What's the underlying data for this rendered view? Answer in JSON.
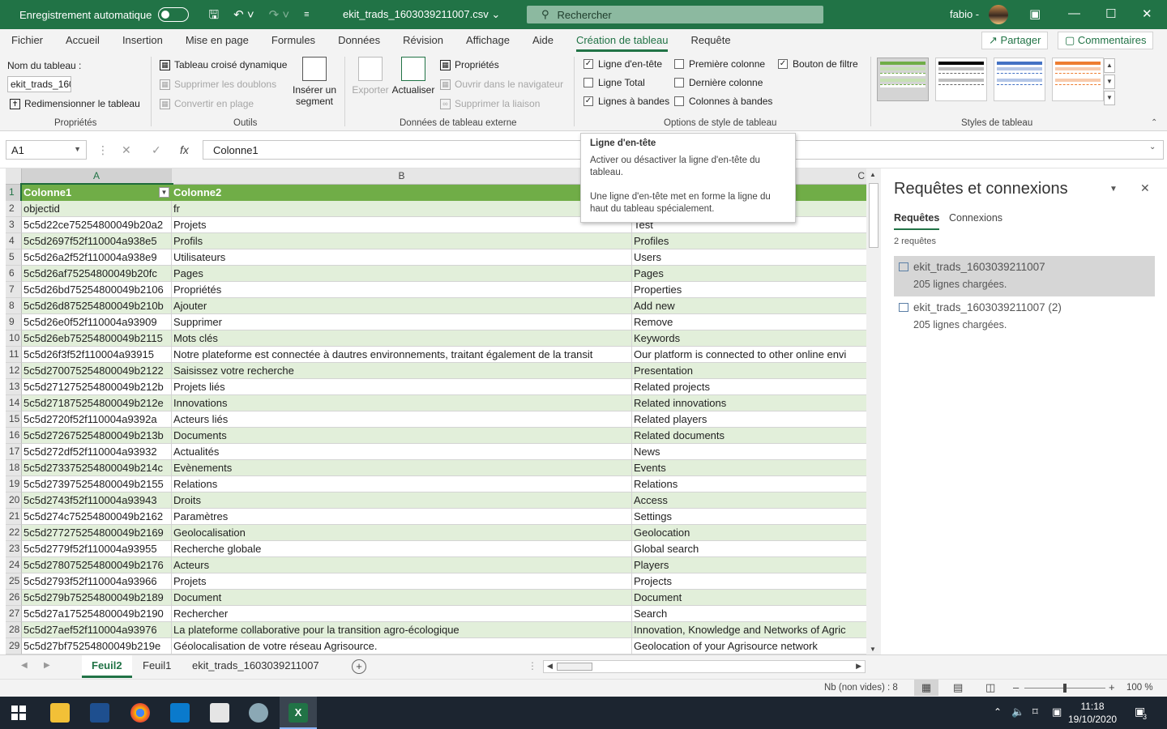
{
  "titlebar": {
    "autosave_label": "Enregistrement automatique",
    "doc_title": "ekit_trads_1603039211007.csv  ⌄",
    "search_placeholder": "Rechercher",
    "user_name": "fabio -"
  },
  "menu": {
    "tabs": [
      "Fichier",
      "Accueil",
      "Insertion",
      "Mise en page",
      "Formules",
      "Données",
      "Révision",
      "Affichage",
      "Aide",
      "Création de tableau",
      "Requête"
    ],
    "share_label": "Partager",
    "comments_label": "Commentaires"
  },
  "ribbon": {
    "props": {
      "name_label": "Nom du tableau :",
      "name_value": "ekit_trads_160",
      "resize_label": "Redimensionner le tableau",
      "group": "Propriétés"
    },
    "tools": {
      "pivot": "Tableau croisé dynamique",
      "remove_dup": "Supprimer les doublons",
      "convert": "Convertir en plage",
      "slicer": "Insérer un segment",
      "group": "Outils"
    },
    "external": {
      "export": "Exporter",
      "refresh": "Actualiser",
      "properties": "Propriétés",
      "open_browser": "Ouvrir dans le navigateur",
      "unlink": "Supprimer la liaison",
      "group": "Données de tableau externe"
    },
    "style_opts": {
      "header_row": "Ligne d'en-tête",
      "total_row": "Ligne Total",
      "banded_rows": "Lignes à bandes",
      "first_col": "Première colonne",
      "last_col": "Dernière colonne",
      "banded_cols": "Colonnes à bandes",
      "filter_btn": "Bouton de filtre",
      "group": "Options de style de tableau"
    },
    "styles_group": "Styles de tableau"
  },
  "formula": {
    "cell_ref": "A1",
    "content": "Colonne1"
  },
  "grid": {
    "col_headers": [
      "A",
      "B",
      "C"
    ],
    "header_row": [
      "Colonne1",
      "Colonne2"
    ],
    "rows": [
      [
        "objectid",
        "fr",
        ""
      ],
      [
        "5c5d22ce75254800049b20a2",
        "Projets",
        "Test"
      ],
      [
        "5c5d2697f52f110004a938e5",
        "Profils",
        "Profiles"
      ],
      [
        "5c5d26a2f52f110004a938e9",
        "Utilisateurs",
        "Users"
      ],
      [
        "5c5d26af75254800049b20fc",
        "Pages",
        "Pages"
      ],
      [
        "5c5d26bd75254800049b2106",
        "Propriétés",
        "Properties"
      ],
      [
        "5c5d26d875254800049b210b",
        "Ajouter",
        "Add new"
      ],
      [
        "5c5d26e0f52f110004a93909",
        "Supprimer",
        "Remove"
      ],
      [
        "5c5d26eb75254800049b2115",
        "Mots clés",
        "Keywords"
      ],
      [
        "5c5d26f3f52f110004a93915",
        "Notre plateforme est connectée à dautres environnements, traitant également de la transit",
        "Our platform is connected to other online envi"
      ],
      [
        "5c5d270075254800049b2122",
        "Saisissez votre recherche",
        "Presentation"
      ],
      [
        "5c5d271275254800049b212b",
        "Projets liés",
        "Related projects"
      ],
      [
        "5c5d271875254800049b212e",
        "Innovations",
        "Related innovations"
      ],
      [
        "5c5d2720f52f110004a9392a",
        "Acteurs liés",
        "Related players"
      ],
      [
        "5c5d272675254800049b213b",
        "Documents",
        "Related documents"
      ],
      [
        "5c5d272df52f110004a93932",
        "Actualités",
        "News"
      ],
      [
        "5c5d273375254800049b214c",
        "Evènements",
        "Events"
      ],
      [
        "5c5d273975254800049b2155",
        "Relations",
        "Relations"
      ],
      [
        "5c5d2743f52f110004a93943",
        "Droits",
        "Access"
      ],
      [
        "5c5d274c75254800049b2162",
        "Paramètres",
        "Settings"
      ],
      [
        "5c5d277275254800049b2169",
        "Geolocalisation",
        "Geolocation"
      ],
      [
        "5c5d2779f52f110004a93955",
        "Recherche globale",
        "Global search"
      ],
      [
        "5c5d278075254800049b2176",
        "Acteurs",
        "Players"
      ],
      [
        "5c5d2793f52f110004a93966",
        "Projets",
        "Projects"
      ],
      [
        "5c5d279b75254800049b2189",
        "Document",
        "Document"
      ],
      [
        "5c5d27a175254800049b2190",
        "Rechercher",
        "Search"
      ],
      [
        "5c5d27aef52f110004a93976",
        "La plateforme collaborative pour la transition agro-écologique",
        "Innovation, Knowledge and Networks of Agric"
      ],
      [
        "5c5d27bf75254800049b219e",
        "Géolocalisation de votre réseau Agrisource.",
        "Geolocation of your Agrisource network"
      ]
    ]
  },
  "tooltip": {
    "title": "Ligne d'en-tête",
    "line1": "Activer ou désactiver la ligne d'en-tête du tableau.",
    "line2": "Une ligne d'en-tête met en forme la ligne du haut du tableau spécialement."
  },
  "pane": {
    "title": "Requêtes et connexions",
    "tab_queries": "Requêtes",
    "tab_connections": "Connexions",
    "count": "2 requêtes",
    "queries": [
      {
        "name": "ekit_trads_1603039211007",
        "sub": "205 lignes chargées."
      },
      {
        "name": "ekit_trads_1603039211007 (2)",
        "sub": "205 lignes chargées."
      }
    ]
  },
  "sheets": [
    "Feuil2",
    "Feuil1",
    "ekit_trads_1603039211007"
  ],
  "status": {
    "count": "Nb (non vides) : 8",
    "zoom": "100 %"
  },
  "taskbar": {
    "time": "11:18",
    "date": "19/10/2020",
    "badge": "3"
  },
  "colors": {
    "excel_green": "#217346",
    "table_header": "#70ad47",
    "band": "#e2efda"
  }
}
